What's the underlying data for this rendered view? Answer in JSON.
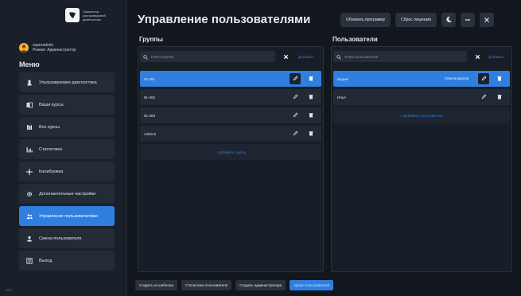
{
  "app": {
    "logo_lines": [
      "Симулятор",
      "ультразвуковой",
      "диагностики"
    ],
    "version": "v.0.0"
  },
  "user": {
    "name": "superadmin",
    "role": "Режим: Администратор"
  },
  "sidebar": {
    "menu_title": "Меню",
    "items": [
      {
        "label": "Ультразвуковая диагностика",
        "icon": "ultrasound-icon",
        "active": false
      },
      {
        "label": "Ваши курсы",
        "icon": "book-icon",
        "active": false
      },
      {
        "label": "Все курсы",
        "icon": "library-icon",
        "active": false
      },
      {
        "label": "Статистика",
        "icon": "chart-icon",
        "active": false
      },
      {
        "label": "Калибровка",
        "icon": "calibration-icon",
        "active": false
      },
      {
        "label": "Дополнительные настройки",
        "icon": "gear-icon",
        "active": false
      },
      {
        "label": "Управление пользователями",
        "icon": "users-icon",
        "active": true
      },
      {
        "label": "Смена пользователя",
        "icon": "user-icon",
        "active": false
      },
      {
        "label": "Выход",
        "icon": "exit-icon",
        "active": false
      }
    ]
  },
  "header": {
    "title": "Управление пользователями",
    "update_label": "Обновить программу",
    "reset_label": "Сброс лицензии"
  },
  "groups": {
    "title": "Группы",
    "search_placeholder": "Поиск группы",
    "add_label": "Добавить",
    "rows": [
      {
        "name": "01-461",
        "selected": true
      },
      {
        "name": "01-462",
        "selected": false
      },
      {
        "name": "01-463",
        "selected": false
      },
      {
        "name": "Admins",
        "selected": false
      }
    ],
    "add_row_label": "+ Добавить группу"
  },
  "users": {
    "title": "Пользователи",
    "search_placeholder": "Поиск пользователя",
    "add_label": "Добавить",
    "rows": [
      {
        "name": "Вадим",
        "tag": "Список курсов",
        "selected": true
      },
      {
        "name": "Илья",
        "tag": "",
        "selected": false
      }
    ],
    "add_row_label": "+ Добавить пользователя"
  },
  "bottom": {
    "buttons": [
      "Создать из шаблона",
      "Статистика пользователя",
      "Создать администратора",
      "Архив пользователей"
    ]
  },
  "colors": {
    "accent": "#2f7fe0",
    "background": "#12161d",
    "panel": "#181e27"
  }
}
